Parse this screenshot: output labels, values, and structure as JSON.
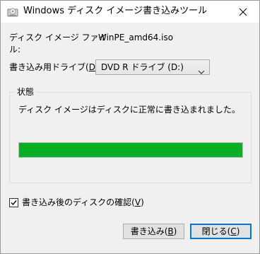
{
  "window": {
    "title": "Windows ディスク イメージ書き込みツール"
  },
  "form": {
    "image_file_label": "ディスク イメージ ファイル:",
    "image_file_label_line1": "ディスク イメージ ファイ",
    "image_file_label_line2": "ル:",
    "image_file_value": "WinPE_amd64.iso",
    "drive_label": "書き込み用ドライブ(D):",
    "drive_label_prefix": "書き込み用ドライブ(",
    "drive_label_accel": "D",
    "drive_label_suffix": "):",
    "drive_value": "DVD R ドライブ (D:)"
  },
  "status": {
    "group_title": "状態",
    "message": "ディスク イメージはディスクに正常に書き込まれました。",
    "progress_percent": 100,
    "progress_color": "#06b025"
  },
  "verify": {
    "checked": true,
    "label": "書き込み後のディスクの確認(V)",
    "label_prefix": "書き込み後のディスクの確認(",
    "label_accel": "V",
    "label_suffix": ")"
  },
  "buttons": {
    "burn_label": "書き込み(B)",
    "burn_prefix": "書き込み(",
    "burn_accel": "B",
    "burn_suffix": ")",
    "close_label": "閉じる(C)",
    "close_prefix": "閉じる(",
    "close_accel": "C",
    "close_suffix": ")"
  },
  "icons": {
    "app": "disc-burner-icon",
    "close": "close-icon",
    "dropdown": "chevron-down-icon",
    "check": "checkmark-icon"
  }
}
